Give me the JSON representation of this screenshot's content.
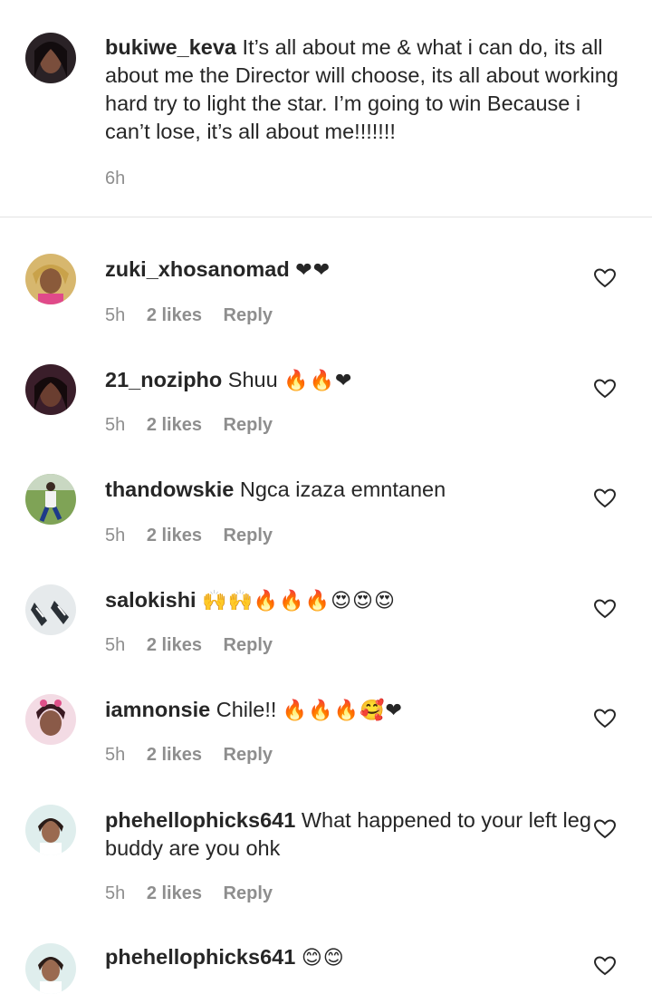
{
  "caption": {
    "username": "bukiwe_keva",
    "text": "It’s all about me & what i can do, its all about me the Director will choose, its all about working hard try to light the star. I’m going to win Because i can’t lose, it’s all about me!!!!!!!",
    "time": "6h"
  },
  "comments": [
    {
      "username": "zuki_xhosanomad",
      "text": "",
      "emoji": "❤❤",
      "time": "5h",
      "likes": "2 likes",
      "reply": "Reply"
    },
    {
      "username": "21_nozipho",
      "text": "Shuu",
      "emoji": "🔥🔥❤",
      "time": "5h",
      "likes": "2 likes",
      "reply": "Reply"
    },
    {
      "username": "thandowskie",
      "text": "Ngca izaza emntanen",
      "emoji": "",
      "time": "5h",
      "likes": "2 likes",
      "reply": "Reply"
    },
    {
      "username": "salokishi",
      "text": "",
      "emoji": "🙌🙌🔥🔥🔥😍😍😍",
      "time": "5h",
      "likes": "2 likes",
      "reply": "Reply"
    },
    {
      "username": "iamnonsie",
      "text": "Chile!!",
      "emoji": "🔥🔥🔥🥰❤",
      "time": "5h",
      "likes": "2 likes",
      "reply": "Reply"
    },
    {
      "username": "phehellophicks641",
      "text": "What happened to your left leg buddy are you ohk",
      "emoji": "",
      "time": "5h",
      "likes": "2 likes",
      "reply": "Reply"
    },
    {
      "username": "phehellophicks641",
      "text": "",
      "emoji": "😊😊",
      "time": "",
      "likes": "",
      "reply": ""
    }
  ],
  "icons": {
    "heart": "heart-outline-icon"
  },
  "colors": {
    "text": "#262626",
    "meta": "#8e8e8e",
    "divider": "#e3e3e3"
  }
}
